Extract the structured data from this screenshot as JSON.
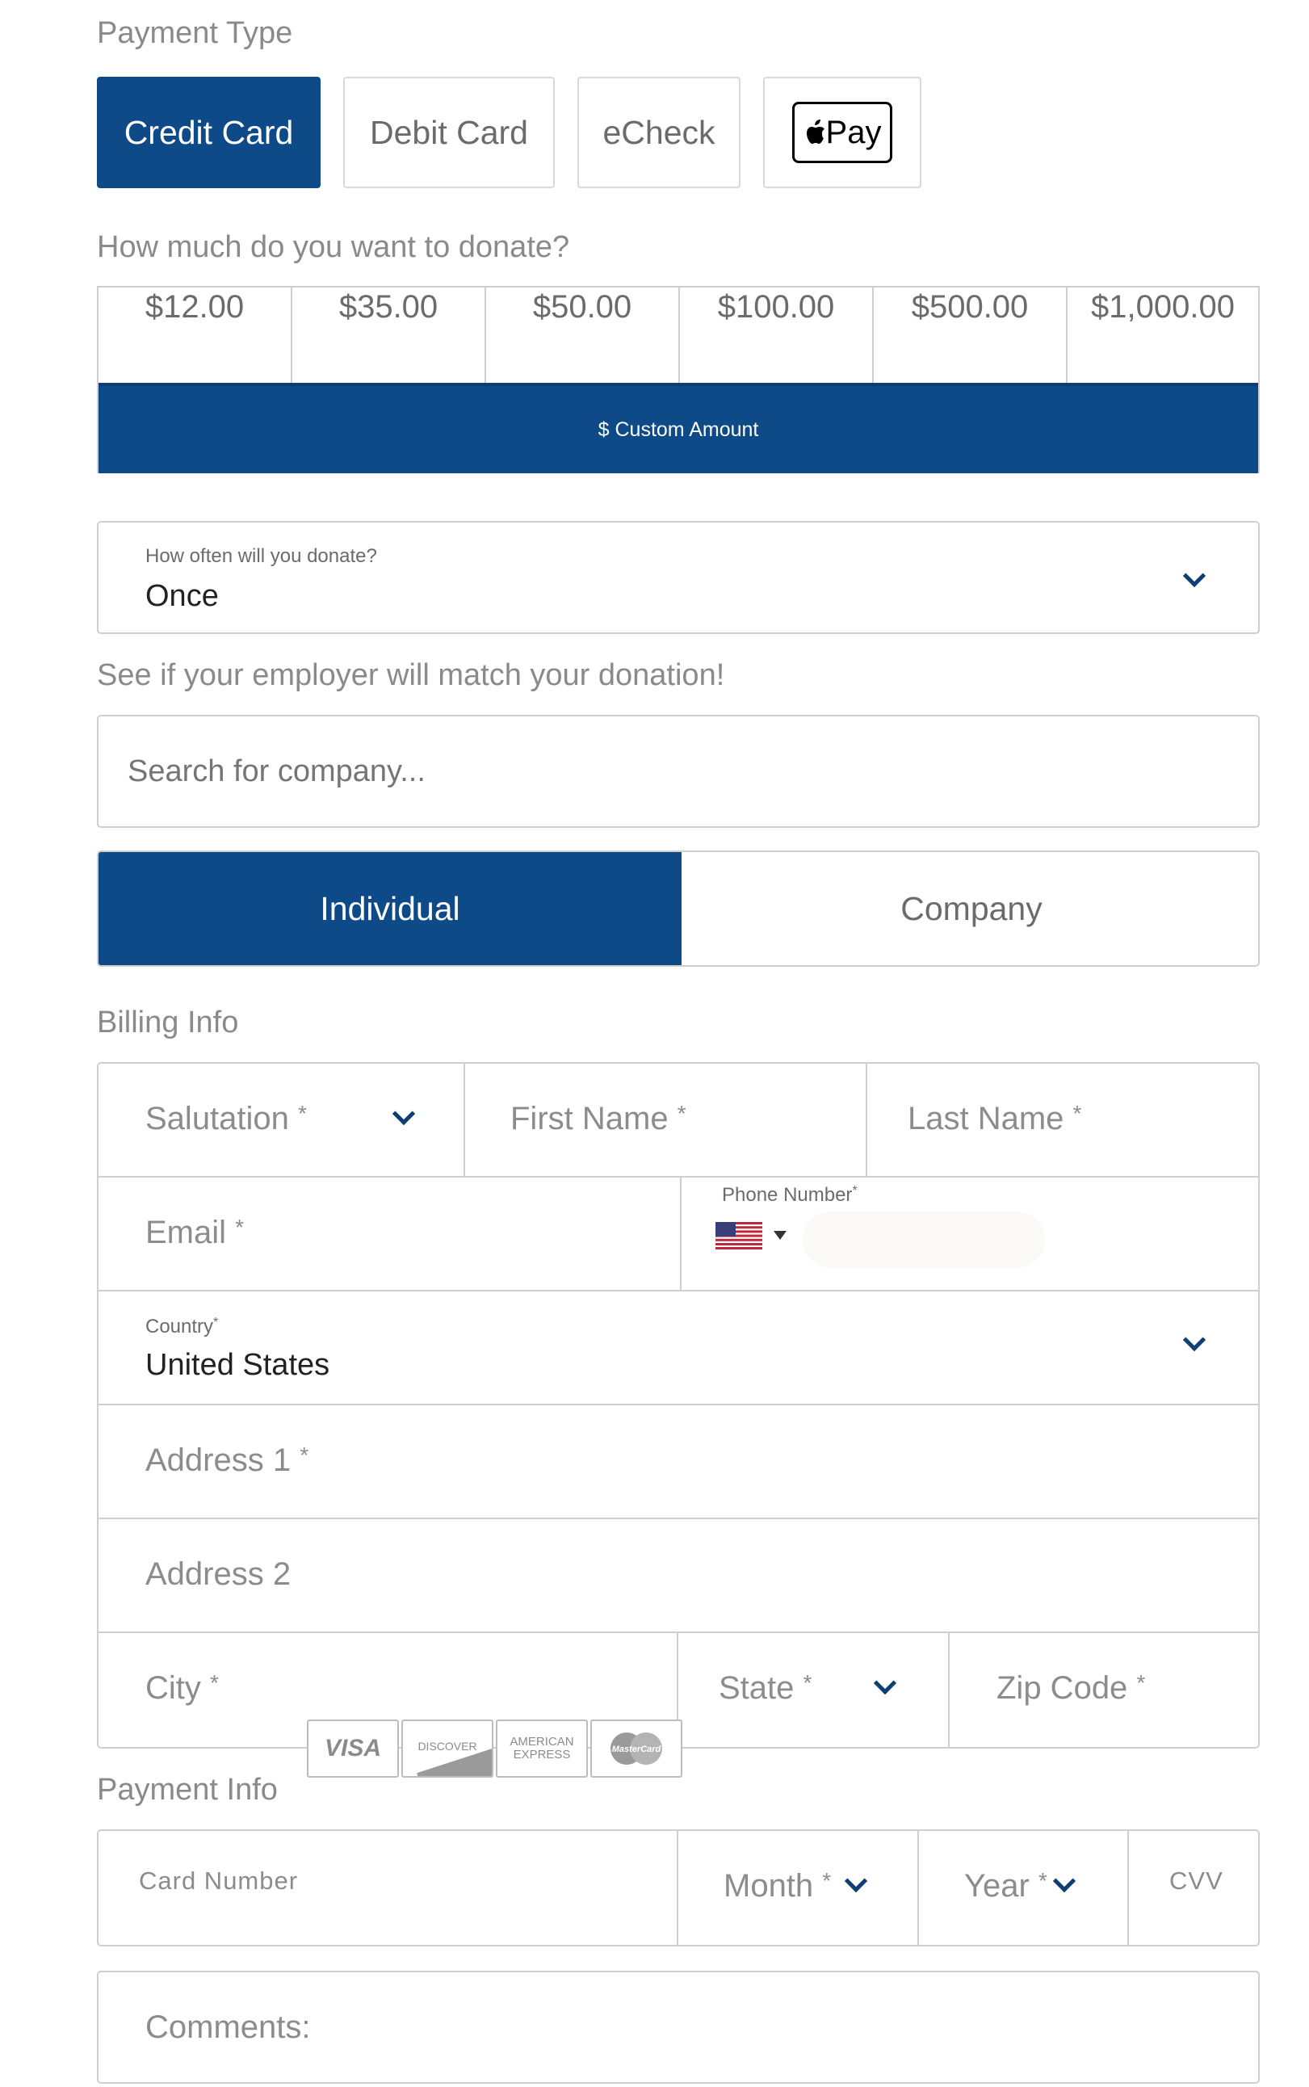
{
  "payment_type": {
    "label": "Payment Type",
    "options": [
      "Credit Card",
      "Debit Card",
      "eCheck"
    ],
    "apple_pay_label": "Pay",
    "selected": "Credit Card"
  },
  "donation": {
    "label": "How much do you want to donate?",
    "amounts": [
      "$12.00",
      "$35.00",
      "$50.00",
      "$100.00",
      "$500.00",
      "$1,000.00"
    ],
    "custom_amount": "$ Custom Amount"
  },
  "frequency": {
    "label": "How often will you donate?",
    "value": "Once"
  },
  "employer_match": {
    "label": "See if your employer will match your donation!",
    "placeholder": "Search for company..."
  },
  "donor_type": {
    "individual": "Individual",
    "company": "Company",
    "selected": "Individual"
  },
  "billing": {
    "label": "Billing Info",
    "salutation": "Salutation",
    "first_name": "First Name",
    "last_name": "Last Name",
    "email": "Email",
    "phone_label": "Phone Number",
    "country_label": "Country",
    "country_value": "United States",
    "address1": "Address 1",
    "address2": "Address 2",
    "city": "City",
    "state": "State",
    "zip": "Zip Code",
    "required_mark": "*"
  },
  "payment_info": {
    "label": "Payment Info",
    "card_logos": [
      "VISA",
      "DISCOVER",
      "AMERICAN EXPRESS",
      "MasterCard"
    ],
    "card_number": "Card Number",
    "month": "Month",
    "year": "Year",
    "cvv": "CVV"
  },
  "comments": {
    "placeholder": "Comments:"
  },
  "colors": {
    "primary": "#0d4a87",
    "border": "#cfcfcf",
    "muted_text": "#8a8a8a"
  }
}
